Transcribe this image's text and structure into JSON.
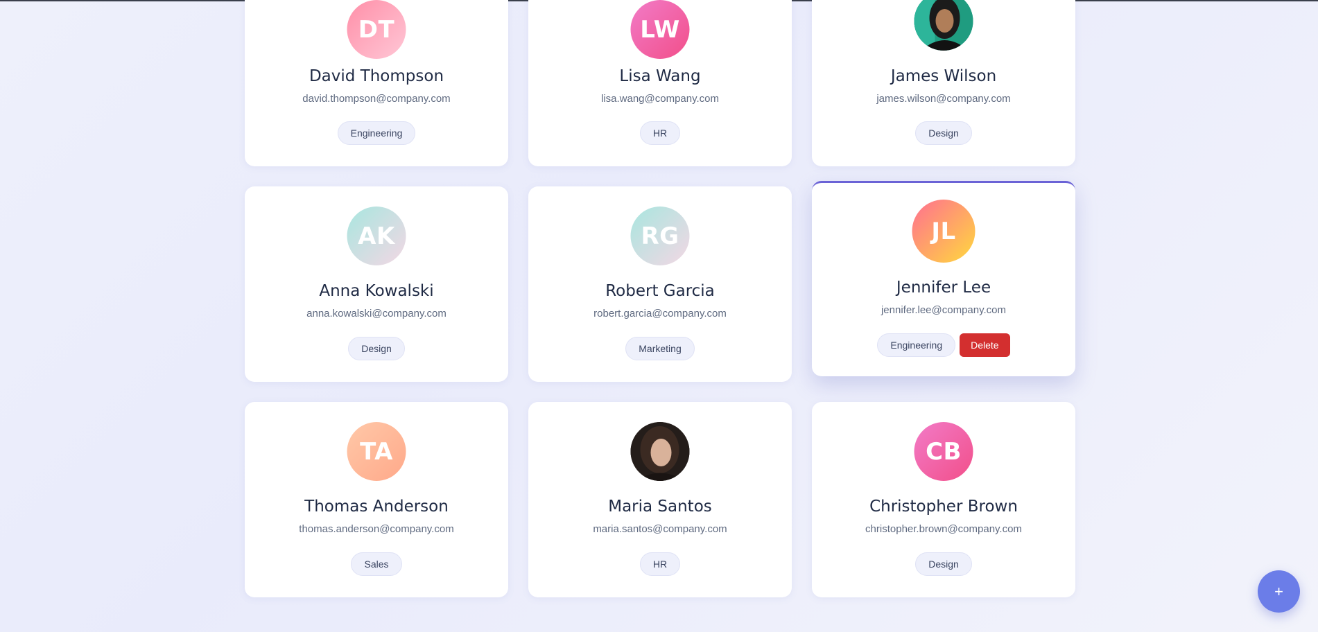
{
  "cards": [
    {
      "initials": "DT",
      "name": "David Thompson",
      "email": "david.thompson@company.com",
      "department": "Engineering"
    },
    {
      "initials": "LW",
      "name": "Lisa Wang",
      "email": "lisa.wang@company.com",
      "department": "HR"
    },
    {
      "initials": "",
      "name": "James Wilson",
      "email": "james.wilson@company.com",
      "department": "Design"
    },
    {
      "initials": "AK",
      "name": "Anna Kowalski",
      "email": "anna.kowalski@company.com",
      "department": "Design"
    },
    {
      "initials": "RG",
      "name": "Robert Garcia",
      "email": "robert.garcia@company.com",
      "department": "Marketing"
    },
    {
      "initials": "JL",
      "name": "Jennifer Lee",
      "email": "jennifer.lee@company.com",
      "department": "Engineering",
      "delete_label": "Delete"
    },
    {
      "initials": "TA",
      "name": "Thomas Anderson",
      "email": "thomas.anderson@company.com",
      "department": "Sales"
    },
    {
      "initials": "",
      "name": "Maria Santos",
      "email": "maria.santos@company.com",
      "department": "HR"
    },
    {
      "initials": "CB",
      "name": "Christopher Brown",
      "email": "christopher.brown@company.com",
      "department": "Design"
    }
  ],
  "fab_label": "+",
  "colors": {
    "delete": "#d32f2f",
    "fab": "#6b7de8",
    "accent": "#6b63d6"
  }
}
